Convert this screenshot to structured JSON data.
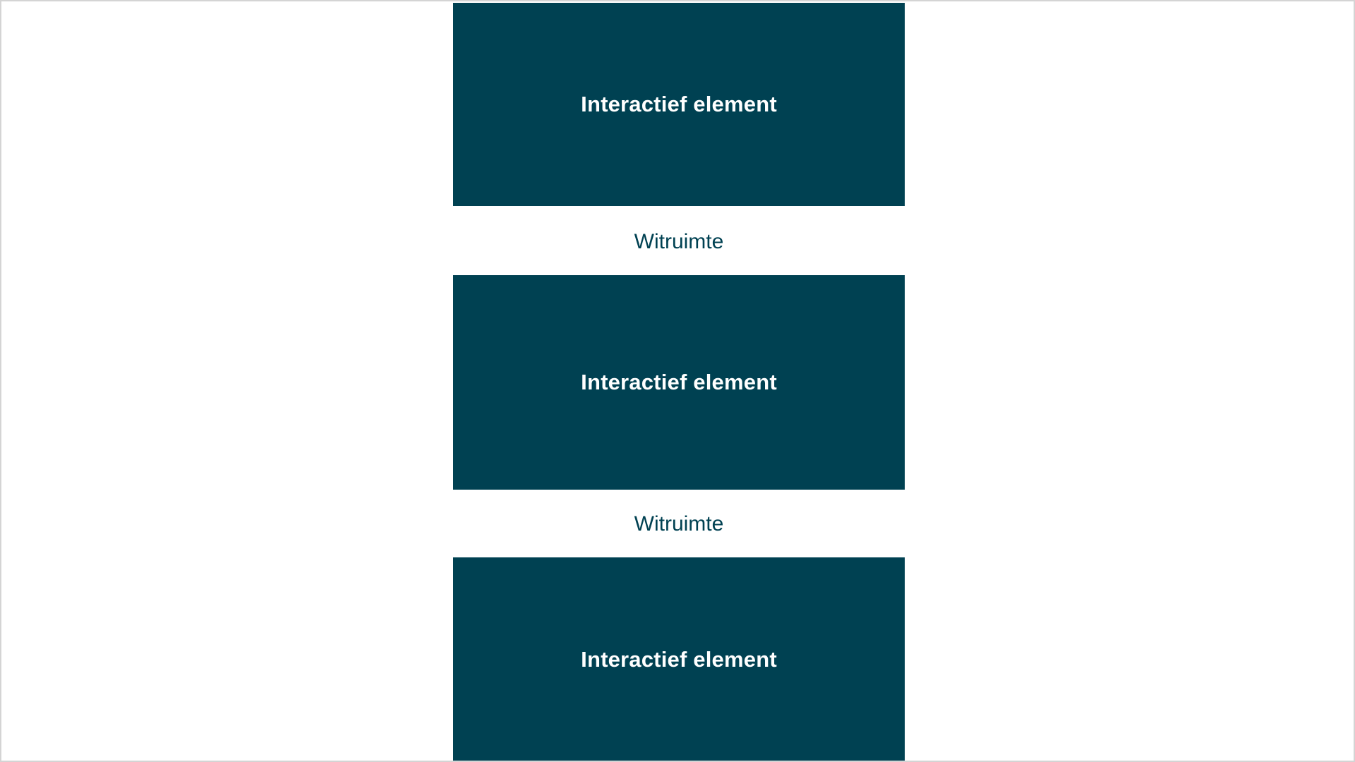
{
  "colors": {
    "block": "#004152",
    "label": "#004152",
    "background": "#ffffff",
    "border": "#d4d4d4"
  },
  "blocks": [
    {
      "label": "Interactief element"
    },
    {
      "label": "Interactief element"
    },
    {
      "label": "Interactief element"
    }
  ],
  "gaps": [
    {
      "label": "Witruimte"
    },
    {
      "label": "Witruimte"
    }
  ]
}
